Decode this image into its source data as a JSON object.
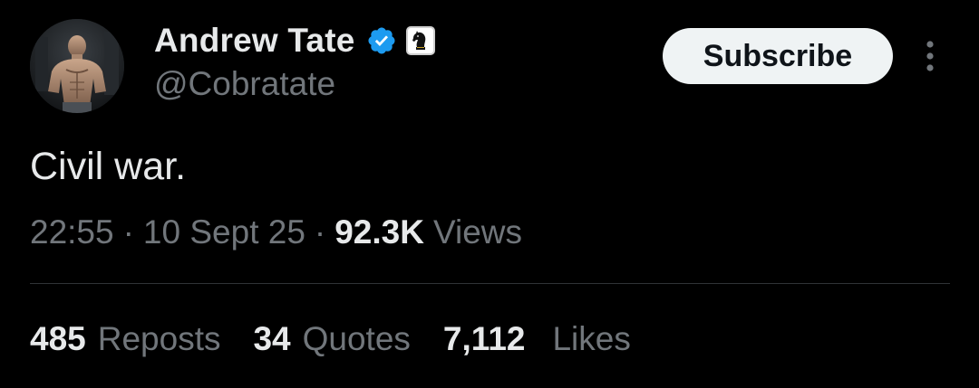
{
  "author": {
    "display_name": "Andrew Tate",
    "handle": "@Cobratate",
    "verified_icon": "verified-badge-icon",
    "affiliate_icon": "chess-knight-icon",
    "colors": {
      "verified": "#1d9bf0"
    }
  },
  "actions": {
    "subscribe_label": "Subscribe",
    "more_icon": "more-vertical-icon"
  },
  "tweet": {
    "text": "Civil war.",
    "time": "22:55",
    "date": "10 Sept 25",
    "separator": "·",
    "views_count": "92.3K",
    "views_label": "Views"
  },
  "stats": {
    "reposts": {
      "count": "485",
      "label": "Reposts"
    },
    "quotes": {
      "count": "34",
      "label": "Quotes"
    },
    "likes": {
      "count": "7,112",
      "label": "Likes"
    }
  }
}
